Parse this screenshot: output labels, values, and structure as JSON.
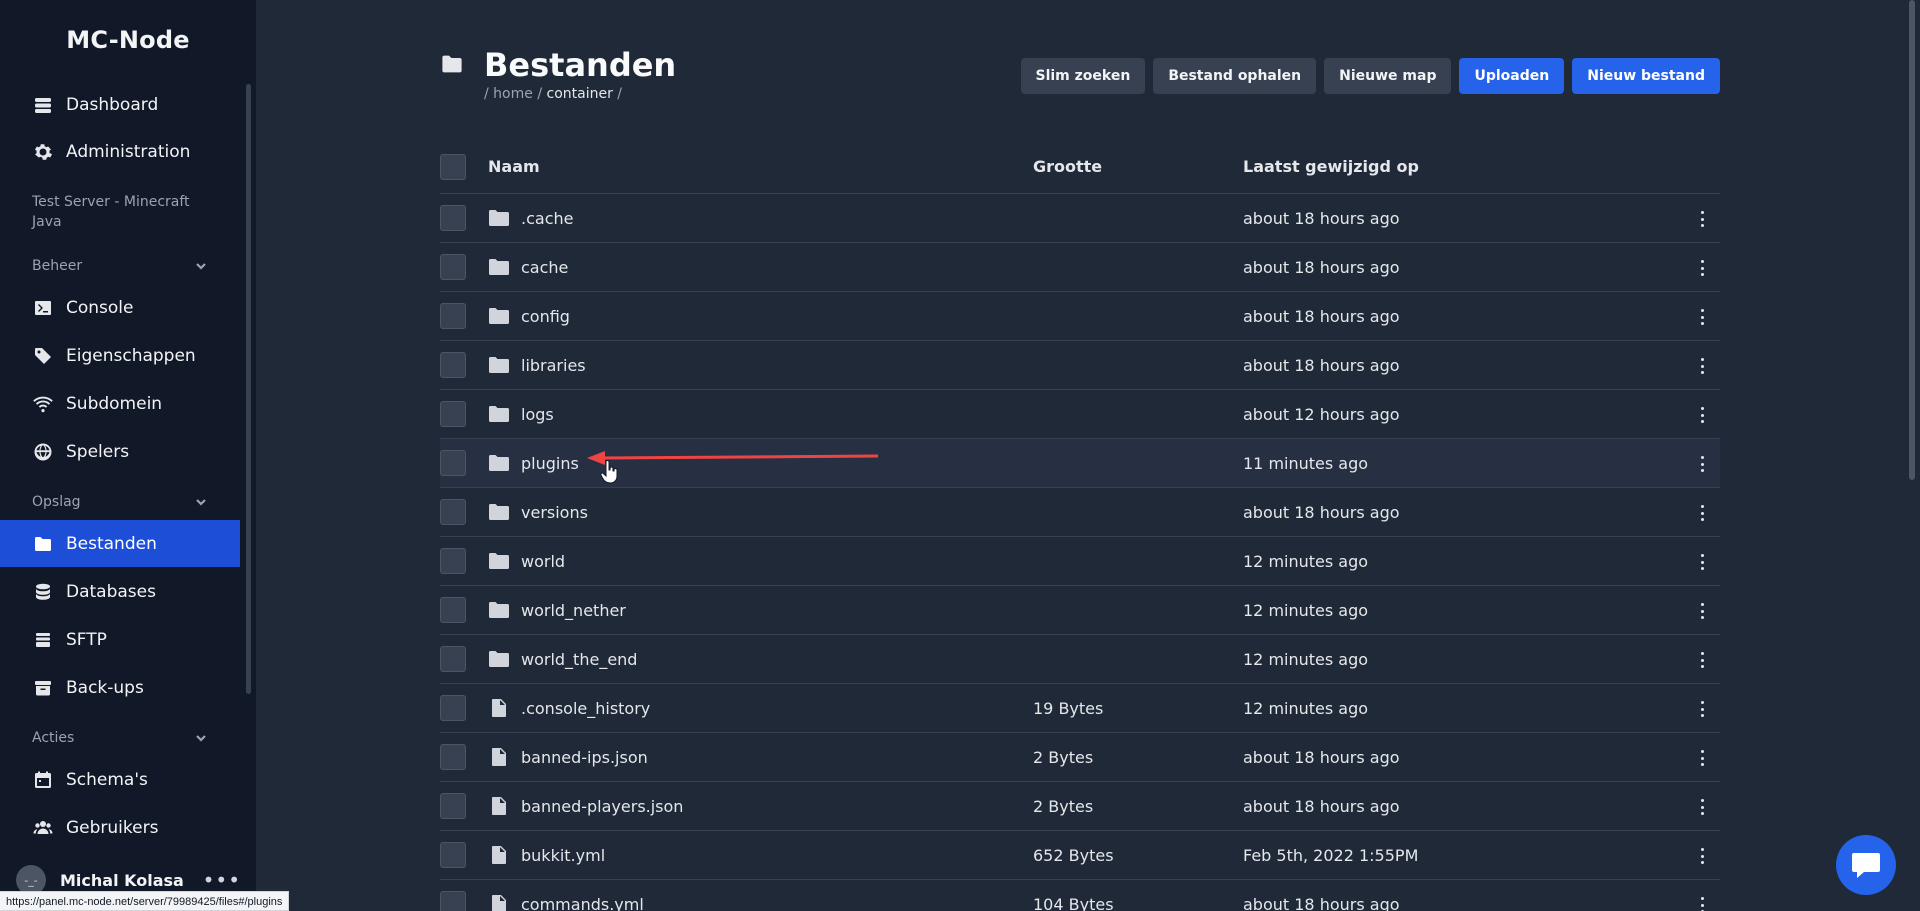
{
  "sidebar": {
    "brand": "MC-Node",
    "items_top": [
      {
        "label": "Dashboard",
        "icon": "server-stack-icon"
      },
      {
        "label": "Administration",
        "icon": "gear-icon"
      }
    ],
    "server_name": "Test Server - Minecraft Java",
    "sections": {
      "beheer": "Beheer",
      "opslag": "Opslag",
      "acties": "Acties"
    },
    "beheer_items": [
      {
        "label": "Console",
        "icon": "terminal-icon"
      },
      {
        "label": "Eigenschappen",
        "icon": "tag-icon"
      },
      {
        "label": "Subdomein",
        "icon": "wifi-icon"
      },
      {
        "label": "Spelers",
        "icon": "globe-icon"
      }
    ],
    "opslag_items": [
      {
        "label": "Bestanden",
        "icon": "folder-icon",
        "active": true
      },
      {
        "label": "Databases",
        "icon": "database-icon"
      },
      {
        "label": "SFTP",
        "icon": "sftp-icon"
      },
      {
        "label": "Back-ups",
        "icon": "archive-icon"
      }
    ],
    "acties_items": [
      {
        "label": "Schema's",
        "icon": "calendar-icon"
      },
      {
        "label": "Gebruikers",
        "icon": "users-icon"
      }
    ],
    "user": {
      "name": "Michal Kolasa",
      "menu": "•••"
    }
  },
  "status_bar_url": "https://panel.mc-node.net/server/79989425/files#/plugins",
  "header": {
    "title": "Bestanden",
    "breadcrumb": {
      "sep1": "/",
      "home": "home",
      "sep2": "/",
      "current": "container",
      "sep3": "/"
    },
    "buttons": {
      "slim_zoeken": "Slim zoeken",
      "bestand_ophalen": "Bestand ophalen",
      "nieuwe_map": "Nieuwe map",
      "uploaden": "Uploaden",
      "nieuw_bestand": "Nieuw bestand"
    }
  },
  "table": {
    "columns": {
      "name": "Naam",
      "size": "Grootte",
      "modified": "Laatst gewijzigd op"
    },
    "rows": [
      {
        "name": ".cache",
        "type": "folder",
        "size": "",
        "modified": "about 18 hours ago"
      },
      {
        "name": "cache",
        "type": "folder",
        "size": "",
        "modified": "about 18 hours ago"
      },
      {
        "name": "config",
        "type": "folder",
        "size": "",
        "modified": "about 18 hours ago"
      },
      {
        "name": "libraries",
        "type": "folder",
        "size": "",
        "modified": "about 18 hours ago"
      },
      {
        "name": "logs",
        "type": "folder",
        "size": "",
        "modified": "about 12 hours ago"
      },
      {
        "name": "plugins",
        "type": "folder",
        "size": "",
        "modified": "11 minutes ago"
      },
      {
        "name": "versions",
        "type": "folder",
        "size": "",
        "modified": "about 18 hours ago"
      },
      {
        "name": "world",
        "type": "folder",
        "size": "",
        "modified": "12 minutes ago"
      },
      {
        "name": "world_nether",
        "type": "folder",
        "size": "",
        "modified": "12 minutes ago"
      },
      {
        "name": "world_the_end",
        "type": "folder",
        "size": "",
        "modified": "12 minutes ago"
      },
      {
        "name": ".console_history",
        "type": "file",
        "size": "19 Bytes",
        "modified": "12 minutes ago"
      },
      {
        "name": "banned-ips.json",
        "type": "file",
        "size": "2 Bytes",
        "modified": "about 18 hours ago"
      },
      {
        "name": "banned-players.json",
        "type": "file",
        "size": "2 Bytes",
        "modified": "about 18 hours ago"
      },
      {
        "name": "bukkit.yml",
        "type": "file",
        "size": "652 Bytes",
        "modified": "Feb 5th, 2022 1:55PM"
      },
      {
        "name": "commands.yml",
        "type": "file",
        "size": "104 Bytes",
        "modified": "about 18 hours ago"
      }
    ]
  },
  "colors": {
    "accent": "#2563eb",
    "annotation_arrow": "#ef4444"
  }
}
